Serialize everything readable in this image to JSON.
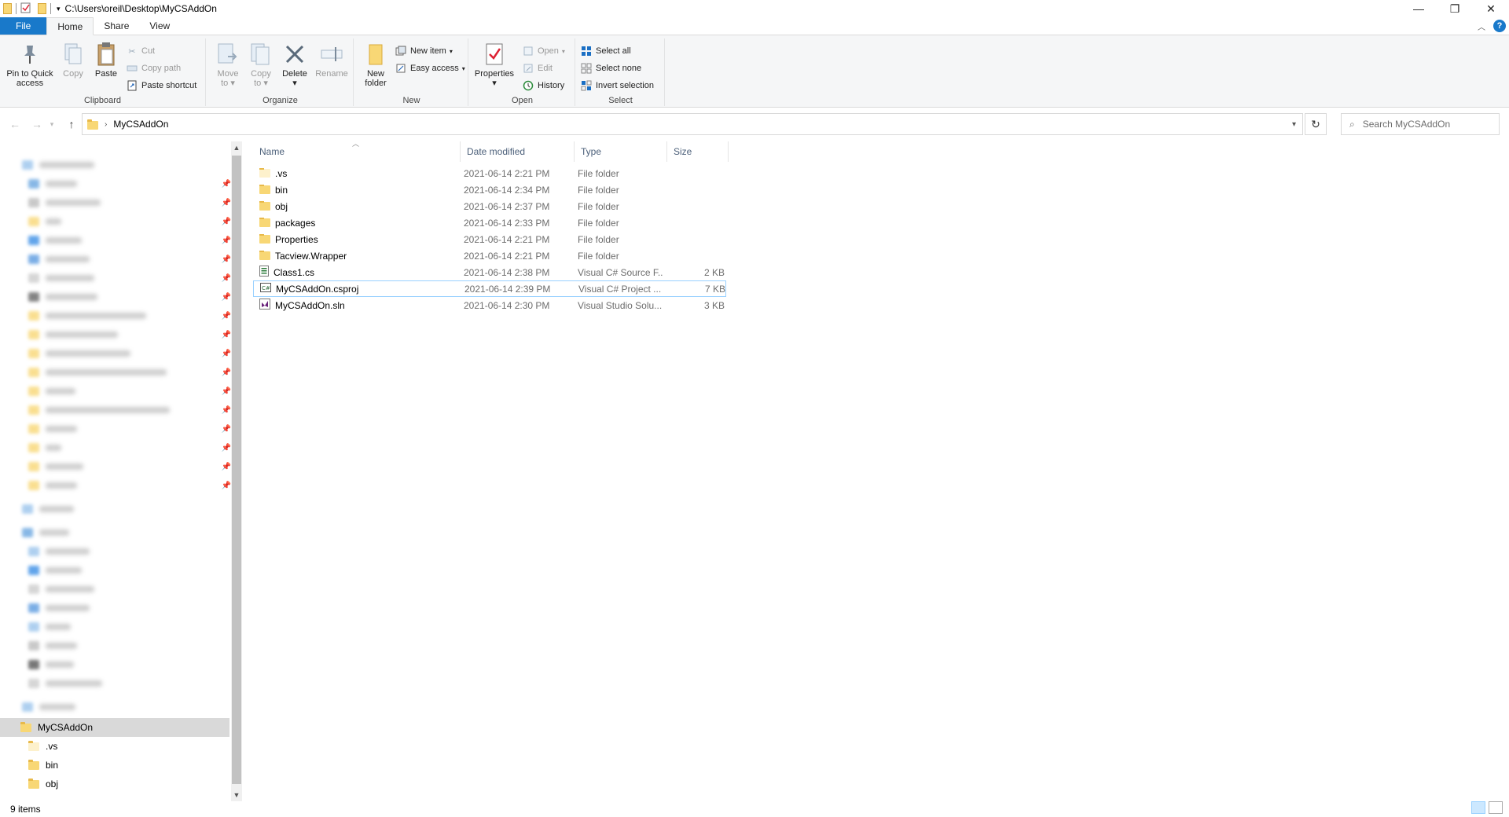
{
  "window": {
    "path": "C:\\Users\\oreil\\Desktop\\MyCSAddOn",
    "minimize_glyph": "—",
    "restore_glyph": "❐",
    "close_glyph": "✕"
  },
  "tabs": [
    {
      "label": "File"
    },
    {
      "label": "Home"
    },
    {
      "label": "Share"
    },
    {
      "label": "View"
    }
  ],
  "ribbon": {
    "clipboard": {
      "label": "Clipboard",
      "pin_label1": "Pin to Quick",
      "pin_label2": "access",
      "copy_label": "Copy",
      "paste_label": "Paste",
      "cut_label": "Cut",
      "copy_path_label": "Copy path",
      "paste_shortcut_label": "Paste shortcut"
    },
    "organize": {
      "label": "Organize",
      "move_label1": "Move",
      "move_label2": "to",
      "copy_label1": "Copy",
      "copy_label2": "to",
      "delete_label": "Delete",
      "rename_label": "Rename"
    },
    "new": {
      "label": "New",
      "new_folder_label1": "New",
      "new_folder_label2": "folder",
      "new_item_label": "New item",
      "easy_access_label": "Easy access"
    },
    "open": {
      "label": "Open",
      "properties_label": "Properties",
      "open_label": "Open",
      "edit_label": "Edit",
      "history_label": "History"
    },
    "select": {
      "label": "Select",
      "select_all_label": "Select all",
      "select_none_label": "Select none",
      "invert_label": "Invert selection"
    }
  },
  "address": {
    "crumb": "MyCSAddOn",
    "search_placeholder": "Search MyCSAddOn"
  },
  "nav": {
    "current_folder": "MyCSAddOn",
    "children": [
      ".vs",
      "bin",
      "obj"
    ]
  },
  "columns": {
    "name": "Name",
    "date": "Date modified",
    "type": "Type",
    "size": "Size"
  },
  "files": [
    {
      "name": ".vs",
      "date": "2021-06-14 2:21 PM",
      "type": "File folder",
      "size": "",
      "kind": "folder"
    },
    {
      "name": "bin",
      "date": "2021-06-14 2:34 PM",
      "type": "File folder",
      "size": "",
      "kind": "folder"
    },
    {
      "name": "obj",
      "date": "2021-06-14 2:37 PM",
      "type": "File folder",
      "size": "",
      "kind": "folder"
    },
    {
      "name": "packages",
      "date": "2021-06-14 2:33 PM",
      "type": "File folder",
      "size": "",
      "kind": "folder"
    },
    {
      "name": "Properties",
      "date": "2021-06-14 2:21 PM",
      "type": "File folder",
      "size": "",
      "kind": "folder"
    },
    {
      "name": "Tacview.Wrapper",
      "date": "2021-06-14 2:21 PM",
      "type": "File folder",
      "size": "",
      "kind": "folder"
    },
    {
      "name": "Class1.cs",
      "date": "2021-06-14 2:38 PM",
      "type": "Visual C# Source F...",
      "size": "2 KB",
      "kind": "cs"
    },
    {
      "name": "MyCSAddOn.csproj",
      "date": "2021-06-14 2:39 PM",
      "type": "Visual C# Project ...",
      "size": "7 KB",
      "kind": "csproj"
    },
    {
      "name": "MyCSAddOn.sln",
      "date": "2021-06-14 2:30 PM",
      "type": "Visual Studio Solu...",
      "size": "3 KB",
      "kind": "sln"
    }
  ],
  "status": {
    "items": "9 items"
  },
  "colors": {
    "file_tab": "#1979ca",
    "folder": "#f8d775",
    "selection_border": "#99d1ff",
    "nav_selected": "#d9d9d9"
  }
}
